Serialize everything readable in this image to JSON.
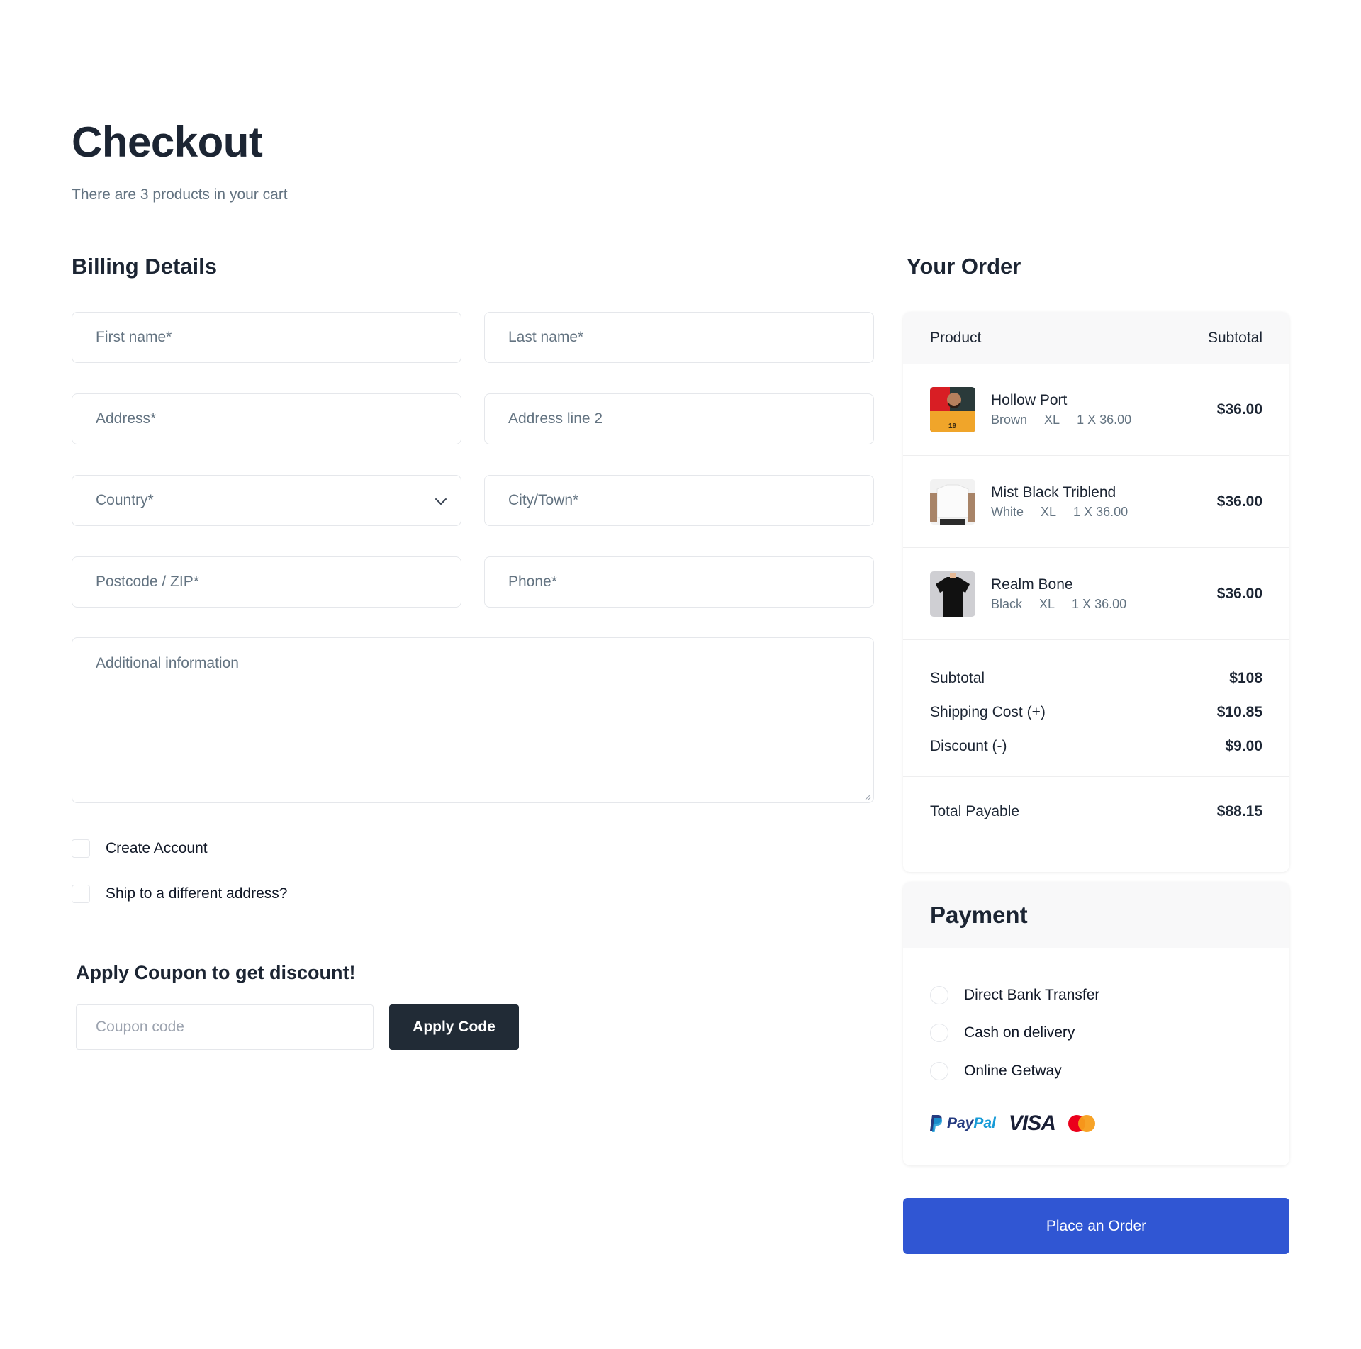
{
  "page": {
    "title": "Checkout",
    "subtitle": "There are 3 products in your cart"
  },
  "billing": {
    "title": "Billing Details",
    "fields": {
      "first_name": "First name*",
      "last_name": "Last name*",
      "address": "Address*",
      "address2": "Address line 2",
      "country": "Country*",
      "city": "City/Town*",
      "postcode": "Postcode / ZIP*",
      "phone": "Phone*",
      "additional": "Additional information"
    },
    "checkboxes": {
      "create_account": "Create Account",
      "ship_different": "Ship to a different address?"
    }
  },
  "coupon": {
    "title": "Apply Coupon to get discount!",
    "placeholder": "Coupon code",
    "button": "Apply Code"
  },
  "order": {
    "title": "Your Order",
    "head_product": "Product",
    "head_subtotal": "Subtotal",
    "items": [
      {
        "name": "Hollow Port",
        "color": "Brown",
        "size": "XL",
        "qty": "1 X 36.00",
        "price": "$36.00"
      },
      {
        "name": "Mist Black Triblend",
        "color": "White",
        "size": "XL",
        "qty": "1 X 36.00",
        "price": "$36.00"
      },
      {
        "name": "Realm Bone",
        "color": "Black",
        "size": "XL",
        "qty": "1 X 36.00",
        "price": "$36.00"
      }
    ],
    "totals": {
      "subtotal_label": "Subtotal",
      "subtotal": "$108",
      "shipping_label": "Shipping Cost (+)",
      "shipping": "$10.85",
      "discount_label": "Discount (-)",
      "discount": "$9.00",
      "payable_label": "Total Payable",
      "payable": "$88.15"
    }
  },
  "payment": {
    "title": "Payment",
    "options": [
      "Direct Bank Transfer",
      "Cash on delivery",
      "Online Getway"
    ],
    "logos": {
      "paypal_pay": "Pay",
      "paypal_pal": "Pal",
      "visa": "VISA"
    }
  },
  "actions": {
    "place_order": "Place an Order"
  },
  "colors": {
    "primary": "#3056d3",
    "dark": "#212b36"
  }
}
